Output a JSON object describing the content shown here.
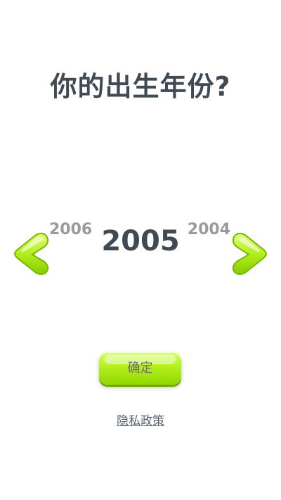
{
  "question": "你的出生年份?",
  "year_picker": {
    "previous_year": "2006",
    "current_year": "2005",
    "next_year": "2004"
  },
  "confirm_button": {
    "label": "确定"
  },
  "privacy_link": {
    "label": "隐私政策"
  },
  "colors": {
    "accent_green": "#a6e516",
    "text_dark": "#3f4a55",
    "text_muted": "#9a9a9a"
  },
  "icons": {
    "left_arrow": "chevron-left-icon",
    "right_arrow": "chevron-right-icon"
  }
}
